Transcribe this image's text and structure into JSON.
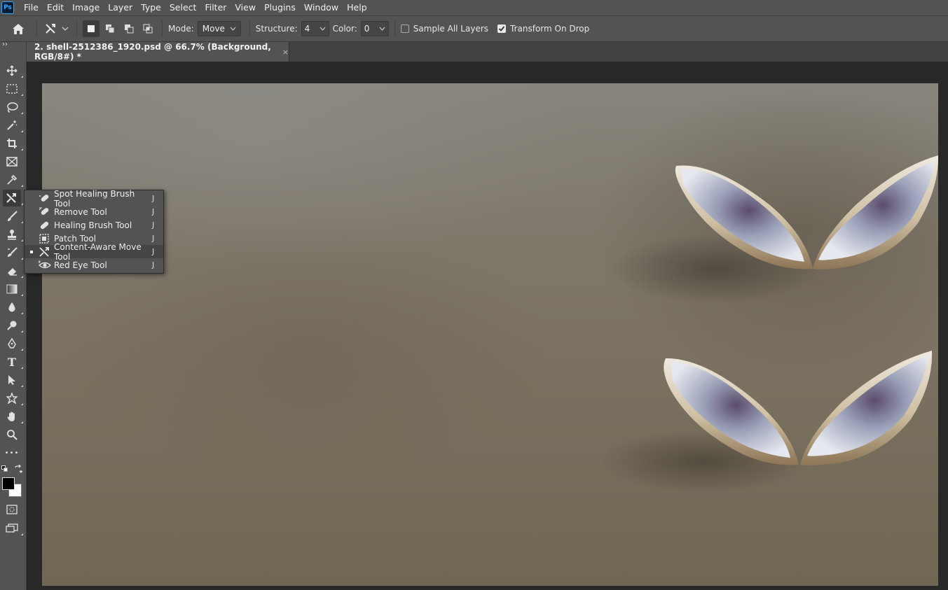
{
  "app": {
    "logo_text": "Ps"
  },
  "menu": [
    "File",
    "Edit",
    "Image",
    "Layer",
    "Type",
    "Select",
    "Filter",
    "View",
    "Plugins",
    "Window",
    "Help"
  ],
  "options": {
    "mode_label": "Mode:",
    "mode_value": "Move",
    "structure_label": "Structure:",
    "structure_value": "4",
    "color_label": "Color:",
    "color_value": "0",
    "sample_all_layers": {
      "label": "Sample All Layers",
      "checked": false
    },
    "transform_on_drop": {
      "label": "Transform On Drop",
      "checked": true
    }
  },
  "document_tab": {
    "title": "2. shell-2512386_1920.psd @ 66.7% (Background, RGB/8#) *",
    "close": "×"
  },
  "toolbox": {
    "collapse": "››",
    "tools": [
      "move-tool",
      "marquee-tool",
      "lasso-tool",
      "magic-wand-tool",
      "crop-tool",
      "frame-tool",
      "eyedropper-tool",
      "content-aware-move-tool",
      "brush-tool",
      "clone-stamp-tool",
      "history-brush-tool",
      "eraser-tool",
      "gradient-tool",
      "blur-tool",
      "dodge-tool",
      "pen-tool",
      "type-tool",
      "path-selection-tool",
      "shape-tool",
      "hand-tool",
      "zoom-tool",
      "edit-toolbar",
      "swap-colors",
      "foreground-color",
      "background-color",
      "quick-mask",
      "screen-mode"
    ],
    "type_glyph": "T",
    "more_glyph": "•••",
    "foreground": "#000000",
    "background": "#ffffff"
  },
  "flyout": {
    "items": [
      {
        "label": "Spot Healing Brush Tool",
        "shortcut": "J",
        "selected": false
      },
      {
        "label": "Remove Tool",
        "shortcut": "J",
        "selected": false
      },
      {
        "label": "Healing Brush Tool",
        "shortcut": "J",
        "selected": false
      },
      {
        "label": "Patch Tool",
        "shortcut": "J",
        "selected": false
      },
      {
        "label": "Content-Aware Move Tool",
        "shortcut": "J",
        "selected": true
      },
      {
        "label": "Red Eye Tool",
        "shortcut": "J",
        "selected": false
      }
    ]
  }
}
